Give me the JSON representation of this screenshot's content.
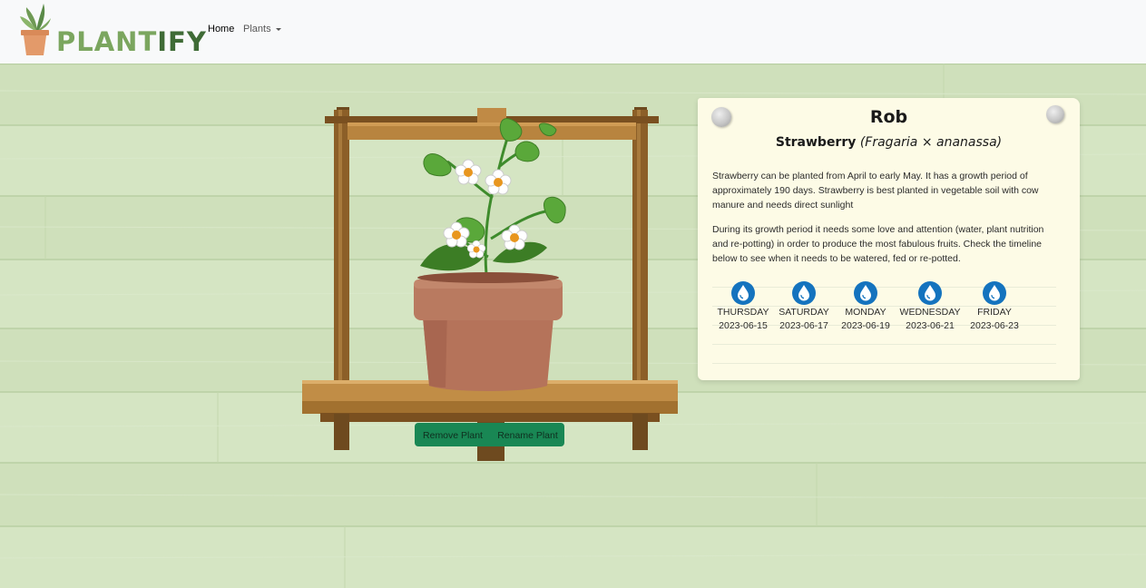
{
  "nav": {
    "brand_part1": "PLANT",
    "brand_part2": "IFY",
    "home_label": "Home",
    "plants_label": "Plants"
  },
  "plant_card": {
    "name": "Rob",
    "common_name": "Strawberry",
    "latin_name": "(Fragaria × ananassa)",
    "description_1": "Strawberry can be planted from April to early May. It has a growth period of approximately 190 days. Strawberry is best planted in vegetable soil with cow manure and needs direct sunlight",
    "description_2": "During its growth period it needs some love and attention (water, plant nutrition and re-potting) in order to produce the most fabulous fruits. Check the timeline below to see when it needs to be watered, fed or re-potted.",
    "timeline": [
      {
        "day": "THURSDAY",
        "date": "2023-06-15",
        "icon": "water-drop-icon"
      },
      {
        "day": "SATURDAY",
        "date": "2023-06-17",
        "icon": "water-drop-icon"
      },
      {
        "day": "MONDAY",
        "date": "2023-06-19",
        "icon": "water-drop-icon"
      },
      {
        "day": "WEDNESDAY",
        "date": "2023-06-21",
        "icon": "water-drop-icon"
      },
      {
        "day": "FRIDAY",
        "date": "2023-06-23",
        "icon": "water-drop-icon"
      }
    ]
  },
  "actions": {
    "remove_label": "Remove Plant",
    "rename_label": "Rename Plant"
  },
  "colors": {
    "accent_green": "#198754",
    "brand_light": "#7ba65f",
    "brand_dark": "#3f6b36",
    "water_blue": "#1473be",
    "pot": "#b5735a",
    "note_paper": "#fdfbe6"
  }
}
